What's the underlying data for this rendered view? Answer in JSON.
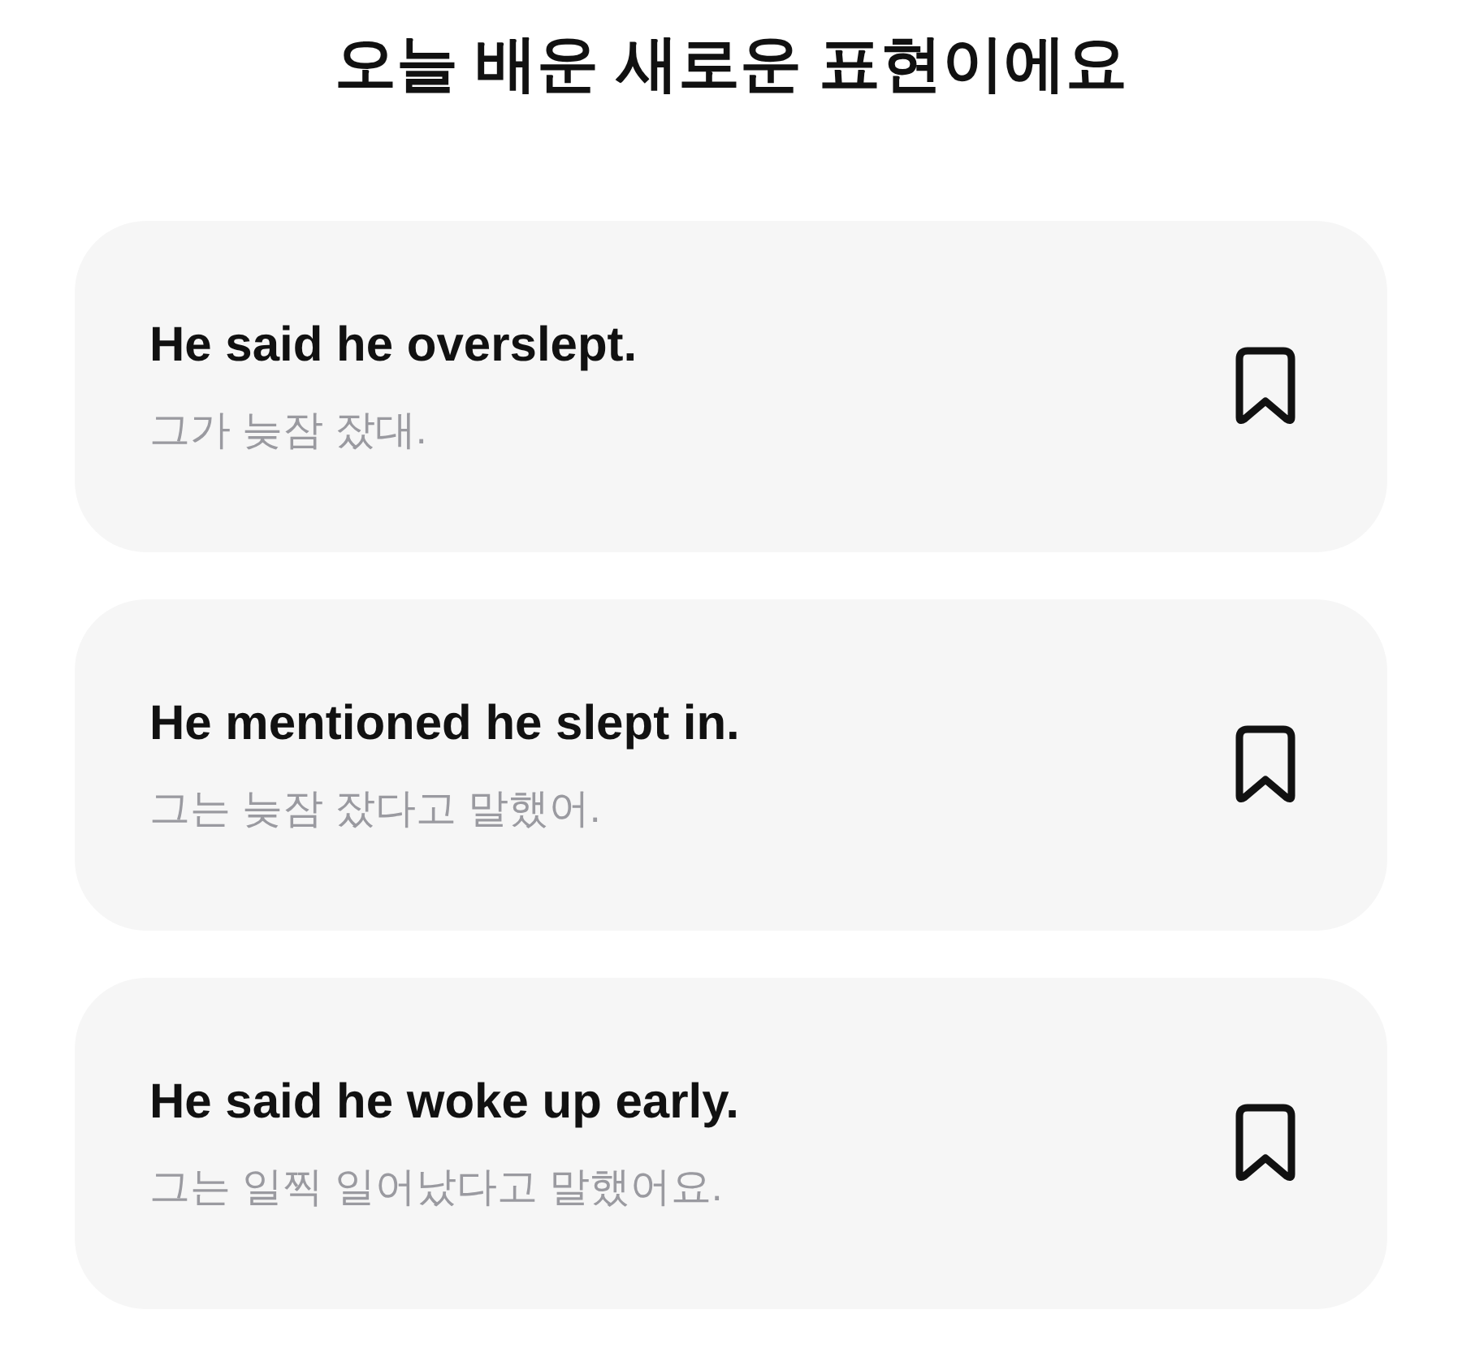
{
  "title": "오늘 배운 새로운 표현이에요",
  "expressions": [
    {
      "english": "He said he overslept.",
      "korean": "그가 늦잠 잤대.",
      "saved": false
    },
    {
      "english": "He mentioned he slept in.",
      "korean": "그는 늦잠 잤다고 말했어.",
      "saved": false
    },
    {
      "english": "He said he woke up early.",
      "korean": "그는 일찍 일어났다고 말했어요.",
      "saved": false
    }
  ]
}
